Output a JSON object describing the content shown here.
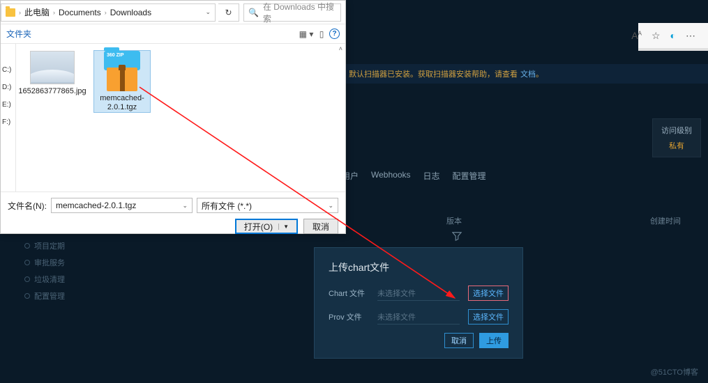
{
  "background": {
    "notice": "默认扫描器已安装。获取扫描器安装帮助，请查看",
    "notice_link": "文档",
    "access": {
      "title": "访问级别",
      "level": "私有"
    },
    "tabs": [
      "用户",
      "Webhooks",
      "日志",
      "配置管理"
    ],
    "columns": {
      "version": "版本",
      "created": "创建时间"
    },
    "side": [
      "项目定期",
      "审批服务",
      "垃圾清理",
      "配置管理"
    ],
    "watermark": "@51CTO博客"
  },
  "upload": {
    "title": "上传chart文件",
    "chart_label": "Chart 文件",
    "prov_label": "Prov 文件",
    "no_file": "未选择文件",
    "select": "选择文件",
    "cancel": "取消",
    "submit": "上传"
  },
  "file_dialog": {
    "crumbs": [
      "此电脑",
      "Documents",
      "Downloads"
    ],
    "search_placeholder": "在 Downloads 中搜索",
    "folder_label": "文件夹",
    "tree": [
      "",
      "",
      "C:)",
      "D:)",
      "E:)",
      "F:)"
    ],
    "files": [
      {
        "name": "1652863777865.jpg",
        "type": "jpg",
        "selected": false
      },
      {
        "name": "memcached-2.0.1.tgz",
        "type": "zip",
        "selected": true,
        "zip_badge": "360 ZIP"
      }
    ],
    "filename_label": "文件名(N):",
    "filename_value": "memcached-2.0.1.tgz",
    "filter": "所有文件 (*.*)",
    "open": "打开(O)",
    "cancel": "取消"
  }
}
